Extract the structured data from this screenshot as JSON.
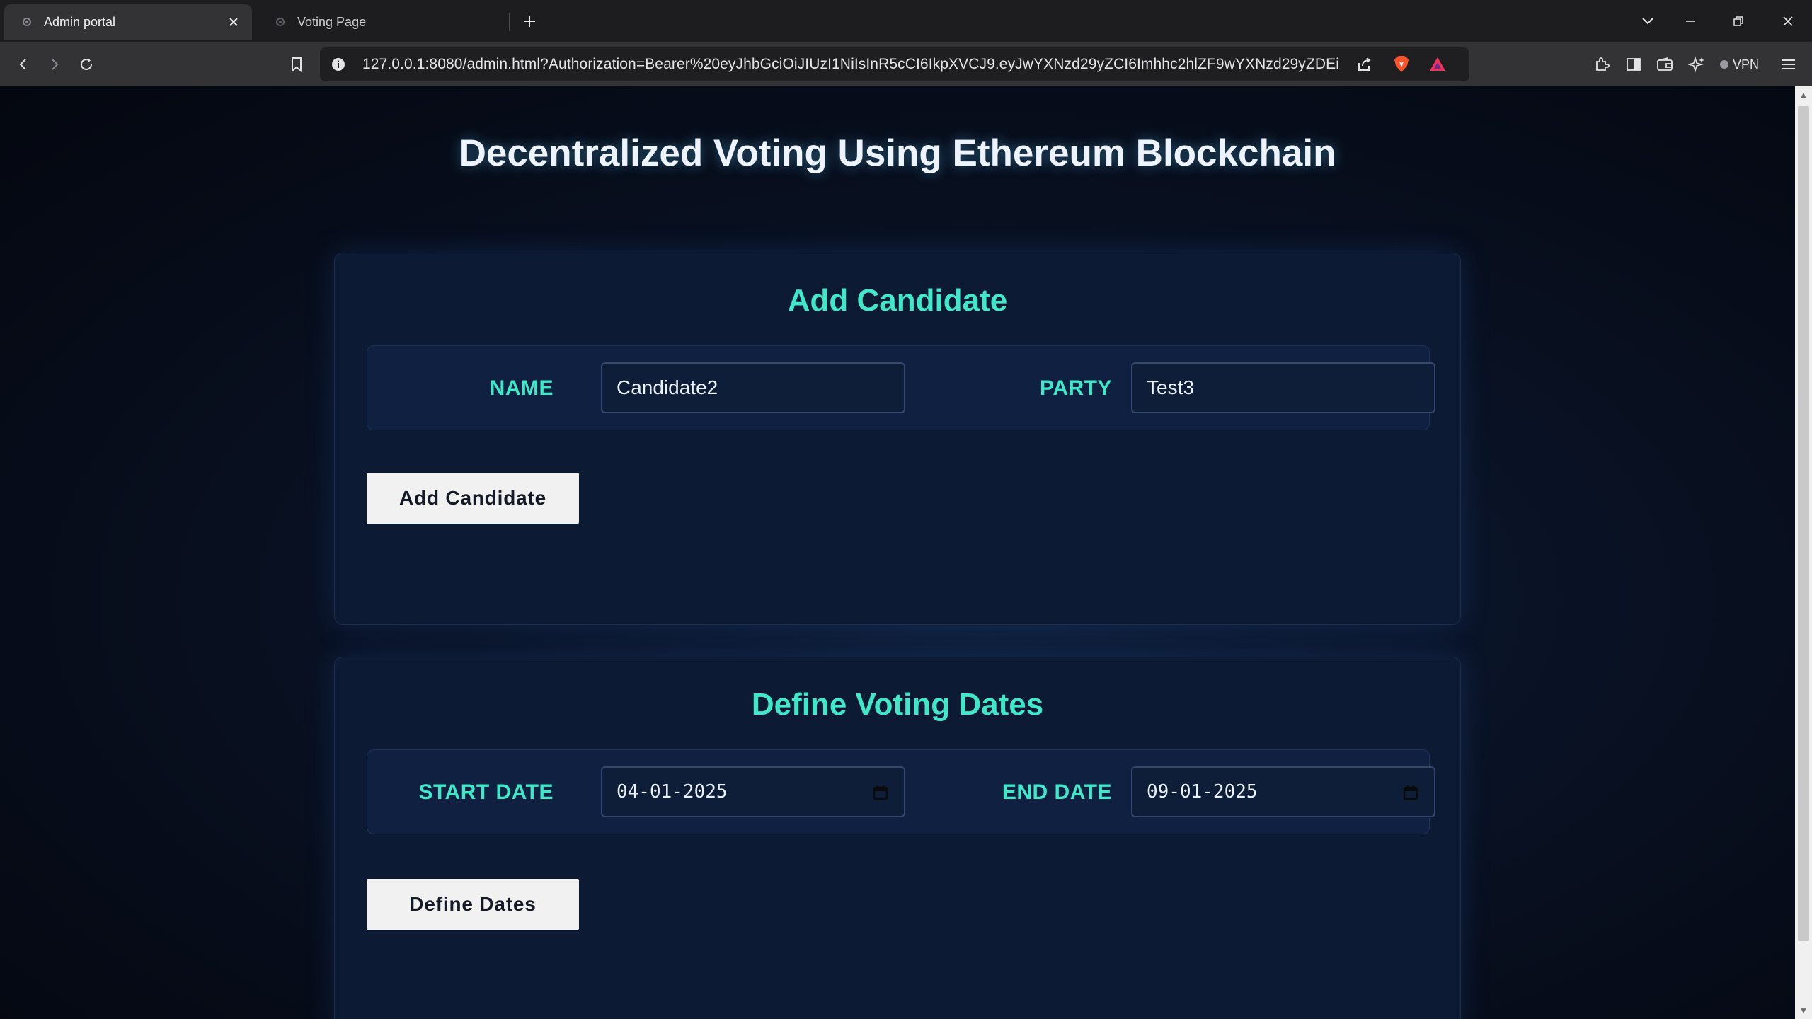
{
  "browser": {
    "tabs": [
      {
        "label": "Admin portal",
        "active": true
      },
      {
        "label": "Voting Page",
        "active": false
      }
    ],
    "url": "127.0.0.1:8080/admin.html?Authorization=Bearer%20eyJhbGciOiJIUzI1NiIsInR5cCI6IkpXVCJ9.eyJwYXNzd29yZCI6Imhhc2hlZF9wYXNzd29yZDEiLCJ2b...",
    "vpn_label": "VPN",
    "icons": [
      "back-icon",
      "forward-icon",
      "reload-icon",
      "bookmark-icon",
      "site-info-icon",
      "share-icon",
      "brave-shield-icon",
      "brave-rewards-icon",
      "extensions-icon",
      "sidebar-icon",
      "wallet-icon",
      "leo-ai-icon",
      "menu-icon"
    ]
  },
  "page": {
    "title": "Decentralized Voting Using Ethereum Blockchain",
    "add_candidate": {
      "heading": "Add Candidate",
      "name_label": "NAME",
      "name_value": "Candidate2",
      "party_label": "PARTY",
      "party_value": "Test3",
      "button_label": "Add Candidate"
    },
    "voting_dates": {
      "heading": "Define Voting Dates",
      "start_label": "START DATE",
      "start_value": "04-01-2025",
      "end_label": "END DATE",
      "end_value": "09-01-2025",
      "button_label": "Define Dates"
    }
  },
  "colors": {
    "accent": "#3ee8c8",
    "background": "#0a1428",
    "card": "#0d1a33",
    "button": "#f1f1f1"
  }
}
